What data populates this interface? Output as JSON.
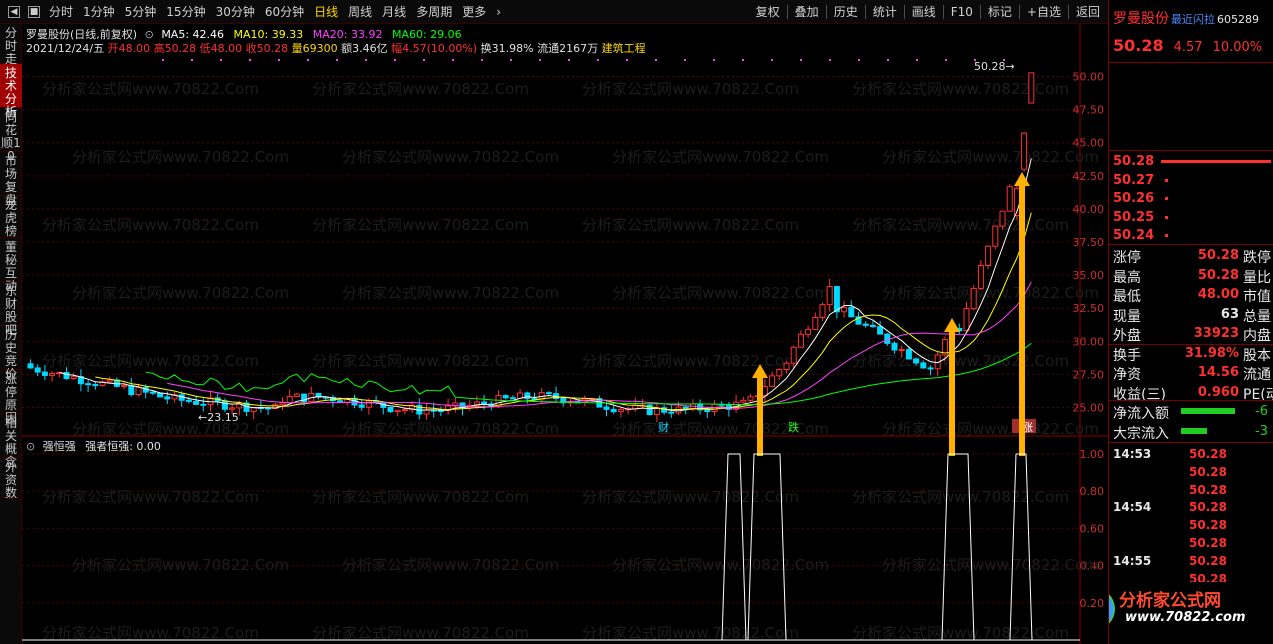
{
  "toolbar": {
    "periods": [
      "分时",
      "1分钟",
      "5分钟",
      "15分钟",
      "30分钟",
      "60分钟",
      "日线",
      "周线",
      "月线",
      "多周期",
      "更多"
    ],
    "active_period": "日线",
    "right_buttons": [
      "复权",
      "叠加",
      "历史",
      "统计",
      "画线",
      "F10",
      "标记",
      "+自选",
      "返回"
    ]
  },
  "left_tabs": [
    "分时走势",
    "技术分析",
    "同花顺10",
    "市场复盘",
    "龙虎榜",
    "董秘互动",
    "东财股吧",
    "历史竞价",
    "涨停原因",
    "相关概念",
    "外资数"
  ],
  "header": {
    "title": "罗曼股份(日线,前复权)",
    "ma5": "MA5: 42.46",
    "ma10": "MA10: 39.33",
    "ma20": "MA20: 33.92",
    "ma60": "MA60: 29.06",
    "date": "2021/12/24/五",
    "open_label": "开",
    "open": "48.00",
    "high_label": "高",
    "high": "50.28",
    "low_label": "低",
    "low": "48.00",
    "close_label": "收",
    "close": "50.28",
    "vol_label": "量",
    "vol": "69300",
    "amt_label": "额",
    "amt": "3.46亿",
    "chg_label": "幅",
    "chg": "4.57(10.00%)",
    "turnover": "换31.98%",
    "float": "流通2167万",
    "sector": "建筑工程"
  },
  "indicator": {
    "name": "强恒强",
    "value": "强者恒强: 0.00"
  },
  "watermark": "分析家公式网www.70822.Com",
  "chart_labels": {
    "low_mark": "23.15",
    "high_mark": "50.28",
    "marker_cai": "财",
    "marker_die": "跌",
    "marker_zhang": "涨"
  },
  "price_axis": [
    "50.00",
    "47.50",
    "45.00",
    "42.50",
    "40.00",
    "37.50",
    "35.00",
    "32.50",
    "30.00",
    "27.50",
    "25.00"
  ],
  "ind_axis": [
    "1.00",
    "0.80",
    "0.60",
    "0.40",
    "0.20"
  ],
  "colors": {
    "up": "#ff3030",
    "down": "#00d8ff",
    "ma5": "#ffffff",
    "ma10": "#ffff00",
    "ma20": "#ff40ff",
    "ma60": "#00ff00",
    "arrow": "#ffb000"
  },
  "right": {
    "stock_name": "罗曼股份",
    "recent_label": "最近闪拉",
    "code": "605289",
    "price": "50.28",
    "change": "4.57",
    "pct": "10.00%",
    "bids": [
      {
        "price": "50.28",
        "vol": ""
      },
      {
        "price": "50.27",
        "vol": ""
      },
      {
        "price": "50.26",
        "vol": ""
      },
      {
        "price": "50.25",
        "vol": ""
      },
      {
        "price": "50.24",
        "vol": ""
      }
    ],
    "stats": [
      {
        "l1": "涨停",
        "v1": "50.28",
        "l2": "跌停"
      },
      {
        "l1": "最高",
        "v1": "50.28",
        "l2": "量比"
      },
      {
        "l1": "最低",
        "v1": "48.00",
        "l2": "市值"
      },
      {
        "l1": "现量",
        "v1": "63",
        "l2": "总量"
      },
      {
        "l1": "外盘",
        "v1": "33923",
        "l2": "内盘"
      },
      {
        "l1": "换手",
        "v1": "31.98%",
        "l2": "股本"
      },
      {
        "l1": "净资",
        "v1": "14.56",
        "l2": "流通"
      },
      {
        "l1": "收益(三)",
        "v1": "0.960",
        "l2": "PE(动"
      }
    ],
    "flows": [
      {
        "label": "净流入额",
        "value": "-6"
      },
      {
        "label": "大宗流入",
        "value": "-3"
      }
    ],
    "ticks": [
      {
        "time": "14:53",
        "price": "50.28"
      },
      {
        "time": "",
        "price": "50.28"
      },
      {
        "time": "",
        "price": "50.28"
      },
      {
        "time": "14:54",
        "price": "50.28"
      },
      {
        "time": "",
        "price": "50.28"
      },
      {
        "time": "",
        "price": "50.28"
      },
      {
        "time": "14:55",
        "price": "50.28"
      },
      {
        "time": "",
        "price": "50.28"
      }
    ],
    "logo_text": "分析家公式网",
    "logo_url": "www.70822.com"
  }
}
